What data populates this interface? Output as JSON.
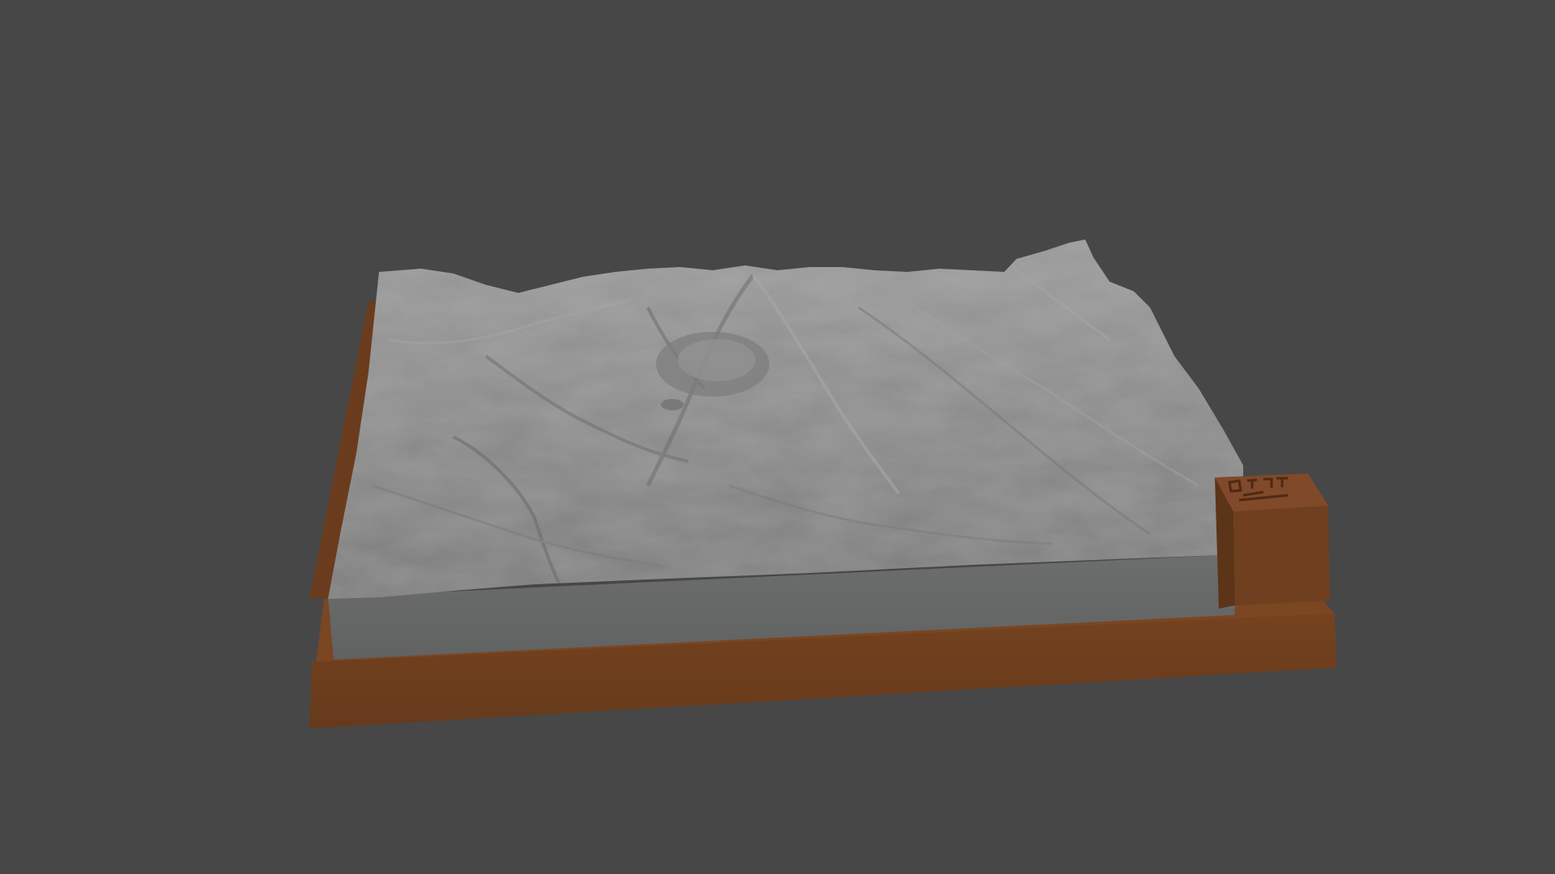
{
  "viewport": {
    "background_color": "#474747"
  },
  "model": {
    "terrain_color": "#8e8e8e",
    "terrain_side_color": "#6a6b6b",
    "base_color": "#6e3f1f",
    "base_shadow_color": "#5c3418",
    "label_block_color": "#74421f"
  }
}
